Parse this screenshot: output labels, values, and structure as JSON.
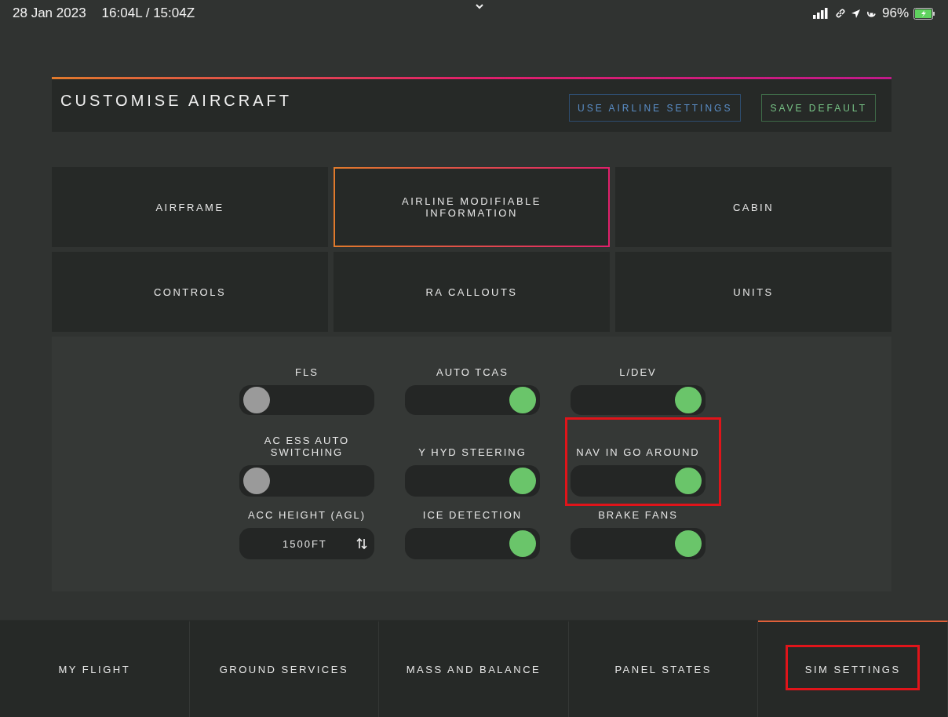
{
  "status_bar": {
    "date": "28 Jan 2023",
    "time": "16:04L / 15:04Z",
    "battery": "96%"
  },
  "header": {
    "title": "CUSTOMISE AIRCRAFT",
    "buttons": [
      {
        "label": "USE AIRLINE SETTINGS",
        "kind": "blue"
      },
      {
        "label": "SAVE DEFAULT",
        "kind": "green"
      }
    ]
  },
  "categories": [
    {
      "label": "AIRFRAME",
      "selected": false
    },
    {
      "label": "AIRLINE MODIFIABLE INFORMATION",
      "selected": true
    },
    {
      "label": "CABIN",
      "selected": false
    },
    {
      "label": "CONTROLS",
      "selected": false
    },
    {
      "label": "RA CALLOUTS",
      "selected": false
    },
    {
      "label": "UNITS",
      "selected": false
    }
  ],
  "settings": [
    {
      "kind": "toggle",
      "label": "FLS",
      "on": false,
      "highlighted": false
    },
    {
      "kind": "toggle",
      "label": "AUTO TCAS",
      "on": true,
      "highlighted": false
    },
    {
      "kind": "toggle",
      "label": "L/DEV",
      "on": true,
      "highlighted": false
    },
    {
      "kind": "toggle",
      "label": "AC ESS AUTO SWITCHING",
      "on": false,
      "highlighted": false
    },
    {
      "kind": "toggle",
      "label": "Y HYD STEERING",
      "on": true,
      "highlighted": false
    },
    {
      "kind": "toggle",
      "label": "NAV IN GO AROUND",
      "on": true,
      "highlighted": true
    },
    {
      "kind": "stepper",
      "label": "ACC HEIGHT (AGL)",
      "value": "1500FT",
      "highlighted": false
    },
    {
      "kind": "toggle",
      "label": "ICE DETECTION",
      "on": true,
      "highlighted": false
    },
    {
      "kind": "toggle",
      "label": "BRAKE FANS",
      "on": true,
      "highlighted": false
    }
  ],
  "nav_tabs": [
    {
      "label": "MY FLIGHT",
      "selected": false,
      "highlighted": false
    },
    {
      "label": "GROUND SERVICES",
      "selected": false,
      "highlighted": false
    },
    {
      "label": "MASS AND BALANCE",
      "selected": false,
      "highlighted": false
    },
    {
      "label": "PANEL STATES",
      "selected": false,
      "highlighted": false
    },
    {
      "label": "SIM SETTINGS",
      "selected": true,
      "highlighted": true
    }
  ]
}
